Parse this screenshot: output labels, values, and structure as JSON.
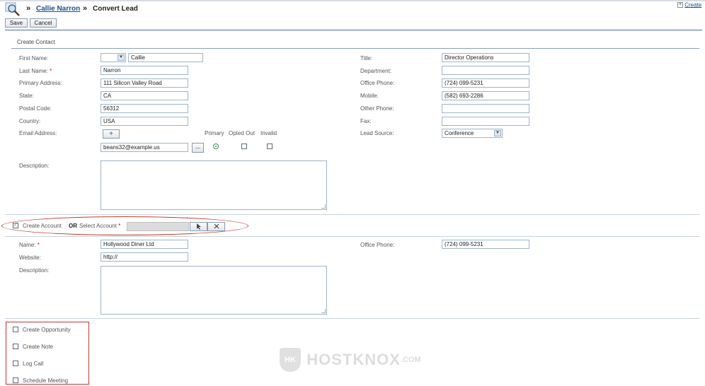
{
  "header": {
    "breadcrumb_sep1": "»",
    "breadcrumb_link": "Callie Narron",
    "breadcrumb_sep2": "»",
    "page_title": "Convert Lead",
    "create_link": "Create"
  },
  "toolbar": {
    "save_label": "Save",
    "cancel_label": "Cancel"
  },
  "contact": {
    "section_title": "Create Contact",
    "first_name": {
      "label": "First Name:",
      "value": "Callie"
    },
    "last_name": {
      "label": "Last Name:",
      "required": "*",
      "value": "Narron"
    },
    "primary_address": {
      "label": "Primary Address:",
      "value": "111 Silicon Valley Road"
    },
    "state": {
      "label": "State:",
      "value": "CA"
    },
    "postal_code": {
      "label": "Postal Code:",
      "value": "56312"
    },
    "country": {
      "label": "Country:",
      "value": "USA"
    },
    "email": {
      "label": "Email Address:",
      "value": "beans32@example.us",
      "col_primary": "Primary",
      "col_opted_out": "Opted Out",
      "col_invalid": "Invalid",
      "add_glyph": "+",
      "remove_glyph": "—"
    },
    "description": {
      "label": "Description:"
    },
    "title": {
      "label": "Title:",
      "value": "Director Operations"
    },
    "department": {
      "label": "Department:",
      "value": ""
    },
    "office_phone": {
      "label": "Office Phone:",
      "value": "(724) 099-5231"
    },
    "mobile": {
      "label": "Mobile:",
      "value": "(582) 693-2286"
    },
    "other_phone": {
      "label": "Other Phone:",
      "value": ""
    },
    "fax": {
      "label": "Fax:",
      "value": ""
    },
    "lead_source": {
      "label": "Lead Source:",
      "value": "Conference"
    }
  },
  "account_toggle": {
    "create_label": "Create Account",
    "or_label": "OR",
    "select_label": "Select Account",
    "required": "*",
    "checked": true,
    "check_glyph": "✓"
  },
  "account": {
    "name": {
      "label": "Name:",
      "required": "*",
      "value": "Hollywood Diner Ltd"
    },
    "website": {
      "label": "Website:",
      "value": "http://"
    },
    "description": {
      "label": "Description:"
    },
    "office_phone": {
      "label": "Office Phone:",
      "value": "(724) 099-5231"
    }
  },
  "options": [
    {
      "label": "Create Opportunity"
    },
    {
      "label": "Create Note"
    },
    {
      "label": "Log Call"
    },
    {
      "label": "Schedule Meeting"
    }
  ],
  "watermark": {
    "brand": "HOSTKNOX",
    "suffix": ".COM",
    "badge": "HK"
  },
  "colors": {
    "link": "#1a4f8a",
    "highlight_oval": "#c0392b",
    "highlight_box": "#c0392b"
  }
}
